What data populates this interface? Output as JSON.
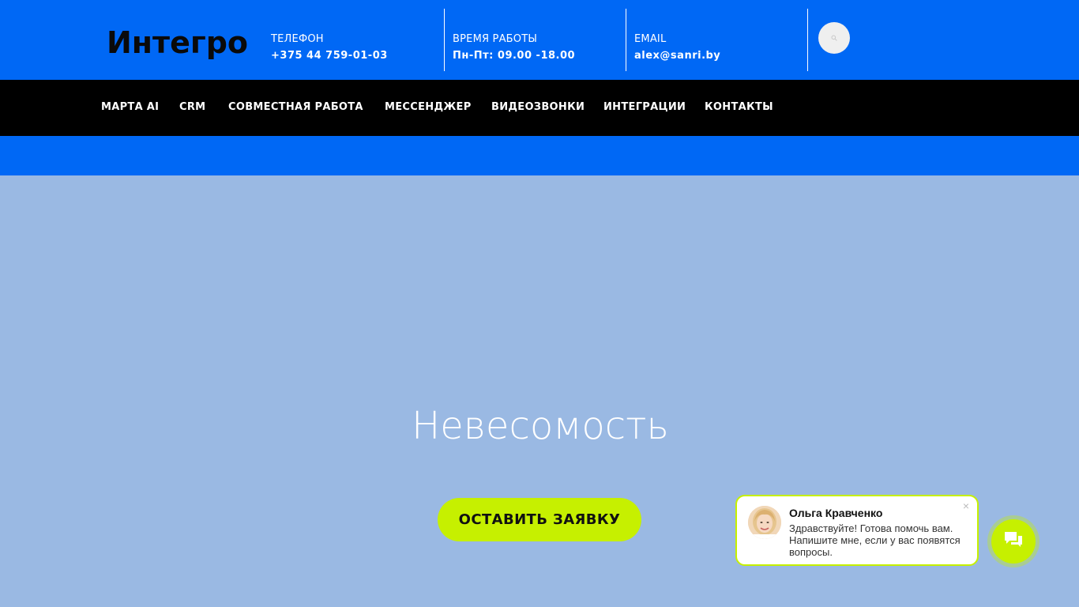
{
  "header": {
    "logo_text": "Интегро",
    "phone": {
      "icon": "phone-icon",
      "icon_glyph": "",
      "label": "ТЕЛЕФОН",
      "value": "+375 44 759-01-03"
    },
    "hours": {
      "icon": "clock-icon",
      "icon_glyph": "",
      "label": "ВРЕМЯ РАБОТЫ",
      "value": "Пн-Пт: 09.00 -18.00"
    },
    "email": {
      "icon": "envelope-icon",
      "icon_glyph": "",
      "label": "EMAIL",
      "value": "alex@sanri.by"
    },
    "search_icon": "search-icon"
  },
  "nav": {
    "items": [
      {
        "label": "МАРТА AI"
      },
      {
        "label": "CRM"
      },
      {
        "label": "СОВМЕСТНАЯ РАБОТА"
      },
      {
        "label": "МЕССЕНДЖЕР"
      },
      {
        "label": "ВИДЕОЗВОНКИ"
      },
      {
        "label": "ИНТЕГРАЦИИ"
      },
      {
        "label": "КОНТАКТЫ"
      }
    ]
  },
  "hero": {
    "title": "Невесомость",
    "cta_label": "ОСТАВИТЬ ЗАЯВКУ"
  },
  "chat": {
    "agent_name": "Ольга Кравченко",
    "message": "Здравствуйте! Готова помочь вам. Напишите мне, если у вас появятся вопросы.",
    "close_glyph": "×",
    "open_icon": "chat-icon"
  },
  "colors": {
    "brand_blue": "#0068f5",
    "accent_lime": "#c6f000",
    "hero_bg": "#9ab9e3",
    "nav_bg": "#000000"
  }
}
